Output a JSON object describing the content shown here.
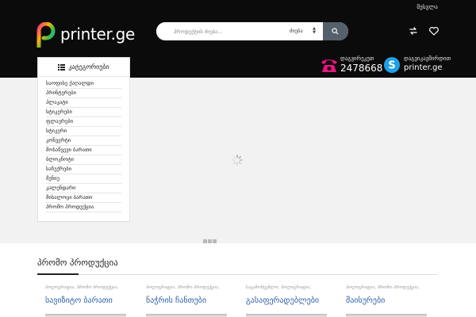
{
  "header": {
    "login_label": "შესვლა",
    "logo_text": "printer.ge",
    "search": {
      "placeholder": "პროდუქტის ძიება...",
      "select_value": "ძიება",
      "icons": {
        "submit": "search-icon",
        "select": "sort-arrows-icon"
      }
    },
    "icons": {
      "compare": "compare-icon",
      "wishlist": "heart-icon"
    },
    "contacts": {
      "phone": {
        "label": "დაგვირეკეთ",
        "value": "2478668",
        "icon": "telephone-icon"
      },
      "skype": {
        "label": "დაგვიკავშირდით",
        "value": "printer.ge",
        "icon": "skype-icon"
      }
    }
  },
  "categories": {
    "title": "კატეგორიები",
    "icon": "menu-list-icon",
    "items": [
      "საოფისე ქაღალდი",
      "პრინტერები",
      "პლაკატი",
      "სტიკერები",
      "ფლაერები",
      "სტიკერი",
      "კონვერტი",
      "მოსაწვევი ბარათი",
      "ბლოკნოტი",
      "საჩუქრები",
      "მენიუ",
      "კალენდარი",
      "მისალოცი ბარათი",
      "პრომო პროდუქცია"
    ]
  },
  "slider": {
    "loader_icon": "loading-spinner-icon",
    "dots_icon": "slider-dots-icon"
  },
  "promo": {
    "title": "პრომო პროდუქცია",
    "products": [
      {
        "category": "პოლიგრაფია, პრომო პროდუქცია,",
        "name": "სავიზიტო ბარათი"
      },
      {
        "category": "პოლიგრაფია, პრომო პროდუქცია,",
        "name": "ნაჭრის ჩანთები"
      },
      {
        "category": "საგამომცემლო, პოლიგრაფია,",
        "name": "გასაფერადებლები"
      },
      {
        "category": "პოლიგრაფია, პრომო პროდუქცია,",
        "name": "მაისურები"
      }
    ]
  },
  "colors": {
    "header_bg": "#0b0b0b",
    "slider_bg": "#f2f2f2",
    "product_link": "#2f5fa8",
    "search_button": "#55606a"
  }
}
